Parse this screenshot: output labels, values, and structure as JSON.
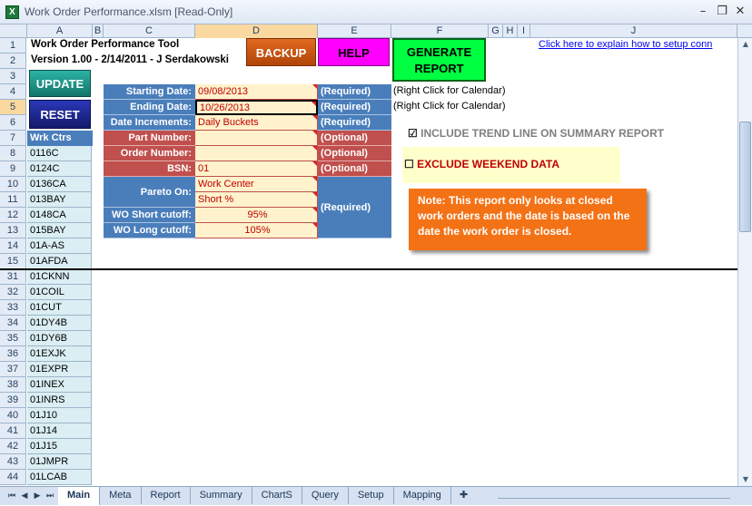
{
  "window": {
    "title": "Work Order Performance.xlsm  [Read-Only]",
    "app_icon": "X",
    "minimize": "–",
    "restore": "❐",
    "close": "✕"
  },
  "columns": [
    "A",
    "B",
    "C",
    "D",
    "E",
    "F",
    "G",
    "H",
    "I",
    "J"
  ],
  "rows": [
    "1",
    "2",
    "3",
    "4",
    "5",
    "6",
    "7",
    "8",
    "9",
    "10",
    "11",
    "12",
    "13",
    "14",
    "15",
    "31",
    "32",
    "33",
    "34",
    "35",
    "36",
    "37",
    "38",
    "39",
    "40",
    "41",
    "42",
    "43",
    "44"
  ],
  "header": {
    "tool_name": "Work Order Performance Tool",
    "version": "Version 1.00 - 2/14/2011 - J Serdakowski",
    "help_link": "Click here to explain how to setup conn"
  },
  "buttons": {
    "update": "UPDATE",
    "reset": "RESET",
    "backup": "BACKUP",
    "help": "HELP",
    "generate_line1": "GENERATE",
    "generate_line2": "REPORT"
  },
  "work_centers": {
    "header": "Wrk Ctrs",
    "items": [
      "0116C",
      "0124C",
      "0136CA",
      "013BAY",
      "0148CA",
      "015BAY",
      "01A-AS",
      "01AFDA",
      "01CKNN",
      "01COIL",
      "01CUT",
      "01DY4B",
      "01DY6B",
      "01EXJK",
      "01EXPR",
      "01INEX",
      "01INRS",
      "01J10",
      "01J14",
      "01J15",
      "01JMPR",
      "01LCAB"
    ]
  },
  "form": {
    "start_label": "Starting Date:",
    "start_value": "09/08/2013",
    "start_status": "(Required)",
    "start_note": "(Right Click for Calendar)",
    "end_label": "Ending Date:",
    "end_value": "10/26/2013",
    "end_status": "(Required)",
    "end_note": "(Right Click for Calendar)",
    "increments_label": "Date Increments:",
    "increments_value": "Daily Buckets",
    "increments_status": "(Required)",
    "part_label": "Part Number:",
    "part_value": "",
    "part_status": "(Optional)",
    "order_label": "Order Number:",
    "order_value": "",
    "order_status": "(Optional)",
    "bsn_label": "BSN:",
    "bsn_value": "01",
    "bsn_status": "(Optional)",
    "pareto_label": "Pareto On:",
    "pareto_value1": "Work Center",
    "pareto_value2": "Short %",
    "pareto_status": "(Required)",
    "wo_short_label": "WO Short cutoff:",
    "wo_short_value": "95%",
    "wo_long_label": "WO Long cutoff:",
    "wo_long_value": "105%"
  },
  "options": {
    "trend_checked": true,
    "trend_mark": "☑",
    "trend_label": "INCLUDE TREND LINE ON SUMMARY REPORT",
    "weekend_checked": false,
    "weekend_mark": "☐",
    "weekend_label": "EXCLUDE WEEKEND DATA"
  },
  "note": {
    "text": "Note: This report only looks at closed work orders and the date is based on the date the work order is closed."
  },
  "sheet_tabs": {
    "tabs": [
      "Main",
      "Meta",
      "Report",
      "Summary",
      "ChartS",
      "Query",
      "Setup",
      "Mapping"
    ],
    "active": "Main"
  },
  "colors": {
    "label_blue": "#4a7ebb",
    "label_red": "#c0504d",
    "input_fill": "#fff2cc",
    "note_orange": "#f47216",
    "update_teal": "#1f9a8e",
    "reset_navy": "#1d2790",
    "backup_orange": "#d45a10",
    "help_magenta": "#ff00ff",
    "generate_green": "#00ff40"
  }
}
